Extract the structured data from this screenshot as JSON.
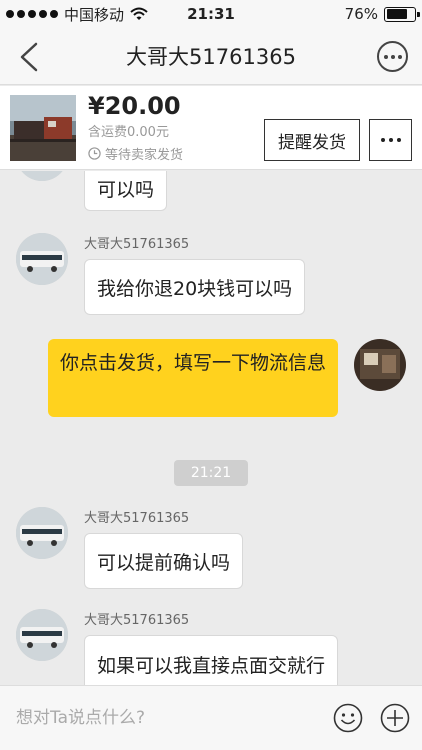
{
  "status_bar": {
    "carrier": "中国移动",
    "time": "21:31",
    "battery_percent": "76%",
    "battery_level": 0.76
  },
  "nav": {
    "title": "大哥大51761365",
    "back_icon": "chevron-left-icon",
    "more_icon": "more-circle-icon"
  },
  "product": {
    "price": "¥20.00",
    "shipping": "含运费0.00元",
    "status": "等待卖家发货",
    "remind_label": "提醒发货",
    "more_icon": "ellipsis-icon"
  },
  "messages": [
    {
      "side": "left",
      "text": "可以吗",
      "avatar_partial": true
    },
    {
      "side": "left",
      "sender": "大哥大51761365",
      "text": "我给你退20块钱可以吗"
    },
    {
      "side": "right",
      "text": "你点击发货，填写一下物流信息"
    },
    {
      "type": "time",
      "text": "21:21"
    },
    {
      "side": "left",
      "sender": "大哥大51761365",
      "text": "可以提前确认吗"
    },
    {
      "side": "left",
      "sender": "大哥大51761365",
      "text": "如果可以我直接点面交就行"
    }
  ],
  "input": {
    "placeholder": "想对Ta说点什么?",
    "emoji_icon": "emoji-smile-icon",
    "plus_icon": "plus-circle-icon"
  },
  "colors": {
    "my_bubble": "#ffd21e",
    "background": "#ebebeb"
  }
}
